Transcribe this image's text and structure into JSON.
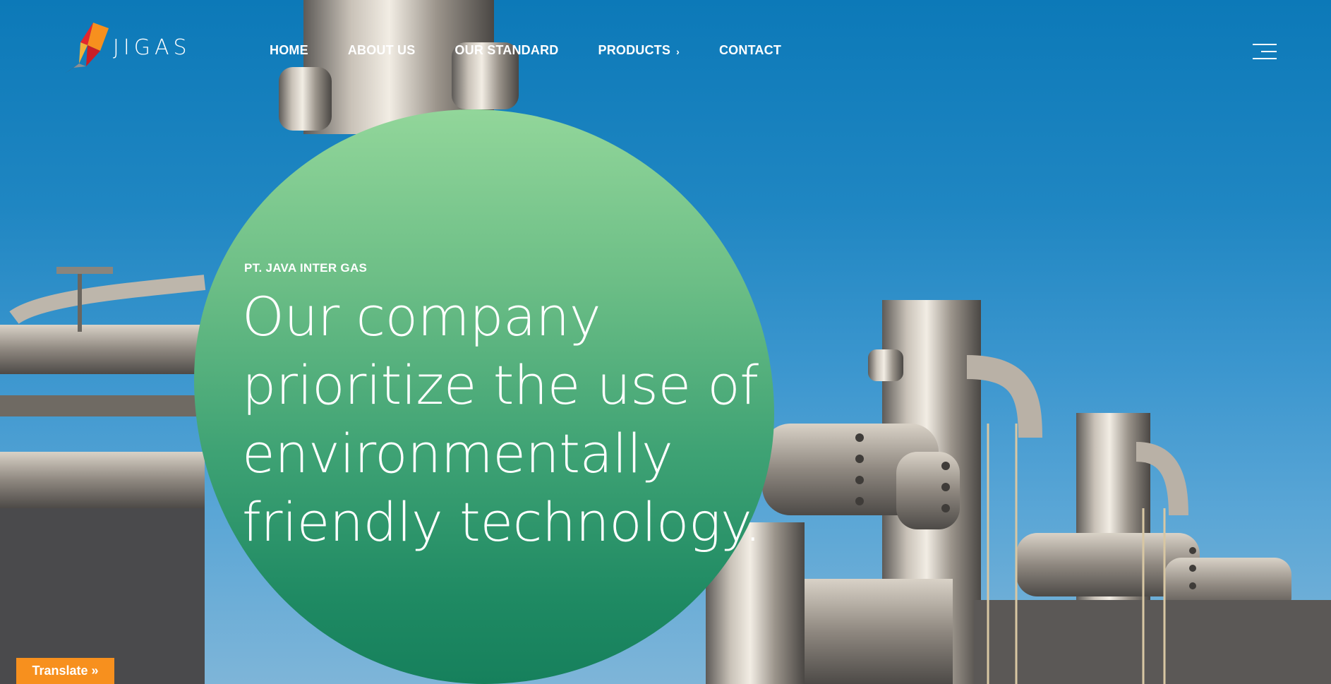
{
  "brand": {
    "name": "JIGAS",
    "logo_icon": "flame-logo-icon"
  },
  "nav": {
    "items": [
      {
        "label": "HOME"
      },
      {
        "label": "ABOUT US"
      },
      {
        "label": "OUR STANDARD"
      },
      {
        "label": "PRODUCTS",
        "chevron": "›"
      },
      {
        "label": "CONTACT"
      }
    ],
    "menu_icon": "hamburger-menu-icon"
  },
  "hero": {
    "kicker": "PT. JAVA INTER GAS",
    "title_lines": [
      "Our company",
      "prioritize the use of",
      "environmentally",
      "friendly technology."
    ],
    "background": "industrial-gas-plant-photo"
  },
  "translate": {
    "label": "Translate »"
  },
  "colors": {
    "sky": "#1f86c2",
    "blob_top": "#92d69a",
    "blob_bottom": "#16805c",
    "translate_bg": "#f7901e",
    "logo_red": "#e3262d",
    "logo_orange": "#f7901e"
  }
}
